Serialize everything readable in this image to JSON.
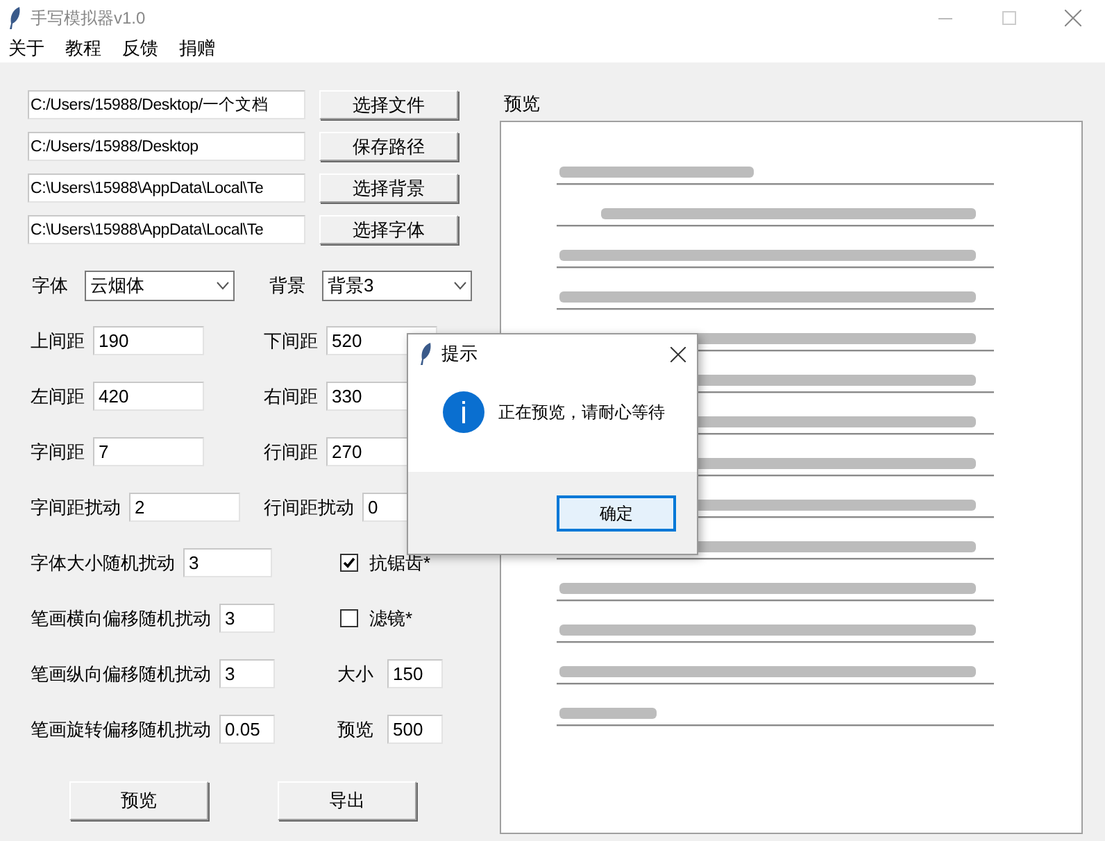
{
  "window": {
    "title": "手写模拟器v1.0"
  },
  "menu": [
    "关于",
    "教程",
    "反馈",
    "捐赠"
  ],
  "paths": [
    {
      "value": "C:/Users/15988/Desktop/一个文档",
      "button": "选择文件"
    },
    {
      "value": "C:/Users/15988/Desktop",
      "button": "保存路径"
    },
    {
      "value": "C:\\Users\\15988\\AppData\\Local\\Te",
      "button": "选择背景"
    },
    {
      "value": "C:\\Users\\15988\\AppData\\Local\\Te",
      "button": "选择字体"
    }
  ],
  "selects": [
    {
      "label": "字体",
      "value": "云烟体"
    },
    {
      "label": "背景",
      "value": "背景3"
    }
  ],
  "field_rows": [
    [
      {
        "label": "上间距",
        "value": "190"
      },
      {
        "label": "下间距",
        "value": "520"
      }
    ],
    [
      {
        "label": "左间距",
        "value": "420"
      },
      {
        "label": "右间距",
        "value": "330"
      }
    ],
    [
      {
        "label": "字间距",
        "value": "7"
      },
      {
        "label": "行间距",
        "value": "270"
      }
    ],
    [
      {
        "label": "字间距扰动",
        "value": "2"
      },
      {
        "label": "行间距扰动",
        "value": "0"
      }
    ]
  ],
  "option_rows": [
    {
      "label": "字体大小随机扰动",
      "value": "3",
      "side": {
        "kind": "checkbox",
        "label": "抗锯齿*",
        "checked": true
      }
    },
    {
      "label": "笔画横向偏移随机扰动",
      "value": "3",
      "side": {
        "kind": "checkbox",
        "label": "滤镜*",
        "checked": false
      }
    },
    {
      "label": "笔画纵向偏移随机扰动",
      "value": "3",
      "side": {
        "kind": "field",
        "label": "大小",
        "value": "150"
      }
    },
    {
      "label": "笔画旋转偏移随机扰动",
      "value": "0.05",
      "side": {
        "kind": "field",
        "label": "预览",
        "value": "500"
      }
    }
  ],
  "actions": [
    "预览",
    "导出"
  ],
  "preview": {
    "title": "预览",
    "kind": "picture"
  },
  "dialog": {
    "title": "提示",
    "message": "正在预览，请耐心等待",
    "button": "确定"
  }
}
